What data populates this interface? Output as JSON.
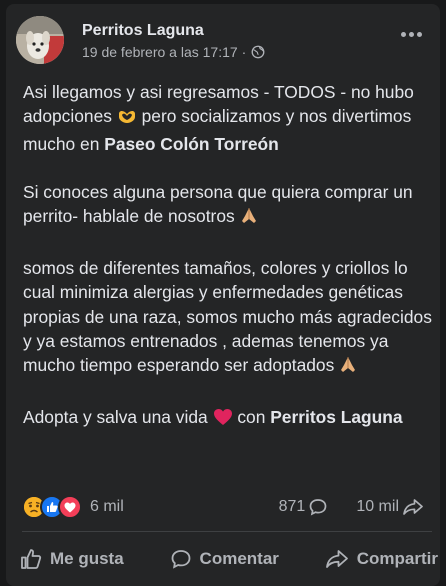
{
  "post": {
    "author": "Perritos Laguna",
    "timestamp": "19 de febrero a las 17:17",
    "separator": "·",
    "privacy_icon": "globe-icon",
    "more_icon": "more-options-icon"
  },
  "body": {
    "p1_a": "Asi llegamos y asi regresamos - TODOS - no hubo adopciones ",
    "p1_b": " pero socializamos y nos divertimos mucho en ",
    "p1_bold": "Paseo Colón Torreón",
    "p2": "Si conoces alguna persona que quiera comprar un perrito- hablale de nosotros ",
    "p3": "somos de diferentes tamaños, colores y criollos lo cual minimiza alergias y enfermedades genéticas propias de una raza, somos mucho más agradecidos y ya estamos entrenados , ademas tenemos ya mucho tiempo esperando ser adoptados ",
    "p4_a": "Adopta y salva una vida ",
    "p4_b": " con ",
    "p4_bold": "Perritos Laguna"
  },
  "stats": {
    "reactions_count": "6 mil",
    "comments_count": "871",
    "shares_count": "10 mil",
    "reaction_icons": [
      "sad-reaction-icon",
      "like-reaction-icon",
      "love-reaction-icon"
    ]
  },
  "actions": {
    "like": "Me gusta",
    "comment": "Comentar",
    "share": "Compartir"
  },
  "colors": {
    "background": "#18191a",
    "card": "#242526",
    "text": "#e4e6eb",
    "secondary_text": "#b0b3b8",
    "like_blue": "#1877f2",
    "love_red": "#f33e58",
    "sad_yellow": "#f7b125"
  }
}
